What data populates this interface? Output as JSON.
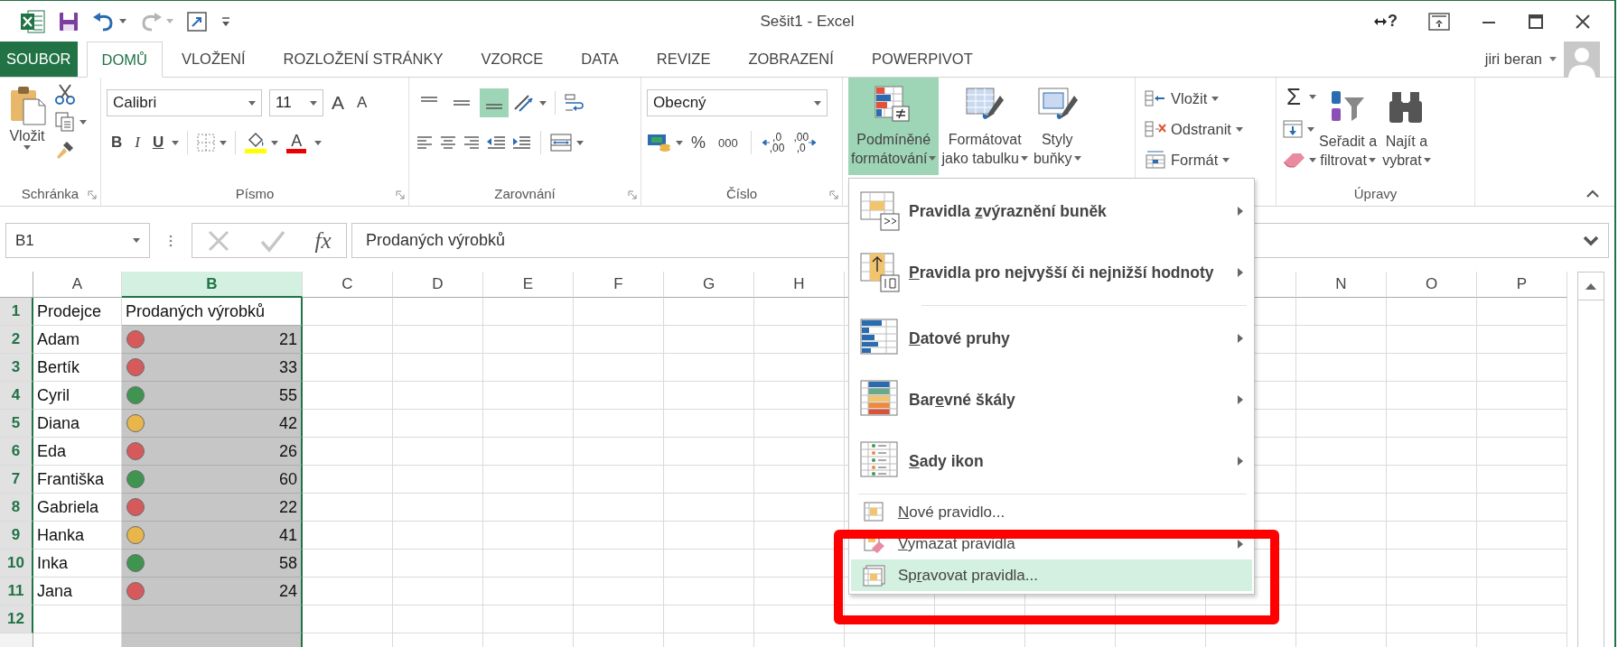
{
  "window": {
    "title": "Sešit1 - Excel",
    "help": "?"
  },
  "quick_access": [
    {
      "kind": "save"
    },
    {
      "kind": "undo",
      "disabled": false
    },
    {
      "kind": "redo",
      "disabled": true
    },
    {
      "kind": "touch"
    },
    {
      "kind": "customize"
    }
  ],
  "tabs": [
    {
      "label": "SOUBOR",
      "kind": "file",
      "selected": false
    },
    {
      "label": "DOMŮ",
      "kind": "tab",
      "selected": true
    },
    {
      "label": "VLOŽENÍ",
      "kind": "tab",
      "selected": false
    },
    {
      "label": "ROZLOŽENÍ STRÁNKY",
      "kind": "tab",
      "selected": false
    },
    {
      "label": "VZORCE",
      "kind": "tab",
      "selected": false
    },
    {
      "label": "DATA",
      "kind": "tab",
      "selected": false
    },
    {
      "label": "REVIZE",
      "kind": "tab",
      "selected": false
    },
    {
      "label": "ZOBRAZENÍ",
      "kind": "tab",
      "selected": false
    },
    {
      "label": "POWERPIVOT",
      "kind": "tab",
      "selected": false
    }
  ],
  "user": {
    "name": "jiri beran"
  },
  "ribbon": {
    "groups": [
      {
        "kind": "clipboard",
        "label": "Schránka",
        "launcher": true,
        "paste": "Vložit"
      },
      {
        "kind": "font",
        "label": "Písmo",
        "launcher": true,
        "font": "Calibri",
        "size": "11",
        "grow": "A",
        "shrink": "A",
        "bold": "B",
        "italic": "I",
        "underline": "U",
        "font_color": "A"
      },
      {
        "kind": "alignment",
        "label": "Zarovnání",
        "launcher": true,
        "vertical": [
          {
            "selected": false
          },
          {
            "selected": false
          },
          {
            "selected": true
          }
        ]
      },
      {
        "kind": "number",
        "label": "Číslo",
        "launcher": true,
        "format": "Obecný",
        "percent": "%",
        "thousands": "000",
        "decimals": [
          {
            "top": ",0",
            "bottom": ",00"
          },
          {
            "top": ",00",
            "bottom": ",0"
          }
        ]
      },
      {
        "kind": "styles",
        "buttons": [
          {
            "kind": "conditional",
            "lines": [
              "Podmíněné",
              "formátování"
            ],
            "active": true
          },
          {
            "kind": "table",
            "lines": [
              "Formátovat",
              "jako tabulku"
            ],
            "active": false
          },
          {
            "kind": "cellstyle",
            "lines": [
              "Styly",
              "buňky"
            ],
            "active": false
          }
        ]
      },
      {
        "kind": "cells",
        "buttons": [
          {
            "kind": "insert",
            "label": "Vložit"
          },
          {
            "kind": "delete",
            "label": "Odstranit"
          },
          {
            "kind": "format",
            "label": "Formát"
          }
        ]
      },
      {
        "kind": "editing",
        "label": "Úpravy",
        "sum": "Σ",
        "buttons": [
          {
            "kind": "sort",
            "lines": [
              "Seřadit a",
              "filtrovat"
            ]
          },
          {
            "kind": "find",
            "lines": [
              "Najít a",
              "vybrat"
            ]
          }
        ]
      }
    ]
  },
  "formula_bar": {
    "name_box": "B1",
    "fx": "fx",
    "value": "Prodaných výrobků"
  },
  "sheet": {
    "columns": [
      {
        "label": "A",
        "selected": false
      },
      {
        "label": "B",
        "selected": true
      },
      {
        "label": "C",
        "selected": false
      },
      {
        "label": "D",
        "selected": false
      },
      {
        "label": "E",
        "selected": false
      },
      {
        "label": "F",
        "selected": false
      },
      {
        "label": "G",
        "selected": false
      },
      {
        "label": "H",
        "selected": false
      }
    ],
    "columns_right": [
      {
        "label": "N",
        "selected": false
      },
      {
        "label": "O",
        "selected": false
      },
      {
        "label": "P",
        "selected": false
      }
    ],
    "rows": [
      {
        "number": "1",
        "kind": "header",
        "selected": true,
        "active": true,
        "name": "Prodejce",
        "value": "Prodaných výrobků"
      },
      {
        "number": "2",
        "kind": "data",
        "selected": true,
        "active": false,
        "name": "Adam",
        "value": "21",
        "color": "#d65a5c"
      },
      {
        "number": "3",
        "kind": "data",
        "selected": true,
        "active": false,
        "name": "Bertík",
        "value": "33",
        "color": "#d65a5c"
      },
      {
        "number": "4",
        "kind": "data",
        "selected": true,
        "active": false,
        "name": "Cyril",
        "value": "55",
        "color": "#3f9550"
      },
      {
        "number": "5",
        "kind": "data",
        "selected": true,
        "active": false,
        "name": "Diana",
        "value": "42",
        "color": "#e8b64a"
      },
      {
        "number": "6",
        "kind": "data",
        "selected": true,
        "active": false,
        "name": "Eda",
        "value": "26",
        "color": "#d65a5c"
      },
      {
        "number": "7",
        "kind": "data",
        "selected": true,
        "active": false,
        "name": "Františka",
        "value": "60",
        "color": "#3f9550"
      },
      {
        "number": "8",
        "kind": "data",
        "selected": true,
        "active": false,
        "name": "Gabriela",
        "value": "22",
        "color": "#d65a5c"
      },
      {
        "number": "9",
        "kind": "data",
        "selected": true,
        "active": false,
        "name": "Hanka",
        "value": "41",
        "color": "#e8b64a"
      },
      {
        "number": "10",
        "kind": "data",
        "selected": true,
        "active": false,
        "name": "Inka",
        "value": "58",
        "color": "#3f9550"
      },
      {
        "number": "11",
        "kind": "data",
        "selected": true,
        "active": false,
        "name": "Jana",
        "value": "24",
        "color": "#d65a5c"
      },
      {
        "number": "12",
        "selected": true,
        "active": false
      }
    ]
  },
  "menu": {
    "items": [
      {
        "kind": "highlight",
        "before": "Pravidla ",
        "access_key": "z",
        "after": "výraznění buněk",
        "submenu": true,
        "selected": false,
        "separator_before": false
      },
      {
        "kind": "topbottom",
        "access_key": "P",
        "after": "ravidla pro nejvyšší či nejnižší hodnoty",
        "submenu": true,
        "selected": false,
        "separator_before": false
      },
      {
        "kind": "databars",
        "access_key": "D",
        "after": "atové pruhy",
        "submenu": true,
        "selected": false,
        "separator_before": true
      },
      {
        "kind": "colorscales",
        "before": "Bar",
        "access_key": "e",
        "after": "vné škály",
        "submenu": true,
        "selected": false,
        "separator_before": false
      },
      {
        "kind": "iconsets",
        "access_key": "S",
        "after": "ady ikon",
        "submenu": true,
        "selected": false,
        "separator_before": false
      },
      {
        "kind": "newrule",
        "access_key": "N",
        "after": "ové pravidlo...",
        "submenu": false,
        "selected": false,
        "separator_before": true
      },
      {
        "kind": "clearrules",
        "access_key": "V",
        "after": "ymazat pravidla",
        "submenu": true,
        "selected": false,
        "separator_before": false
      },
      {
        "kind": "managerules",
        "before": "Sp",
        "access_key": "r",
        "after": "avovat pravidla...",
        "submenu": false,
        "selected": true,
        "separator_before": false
      }
    ]
  }
}
